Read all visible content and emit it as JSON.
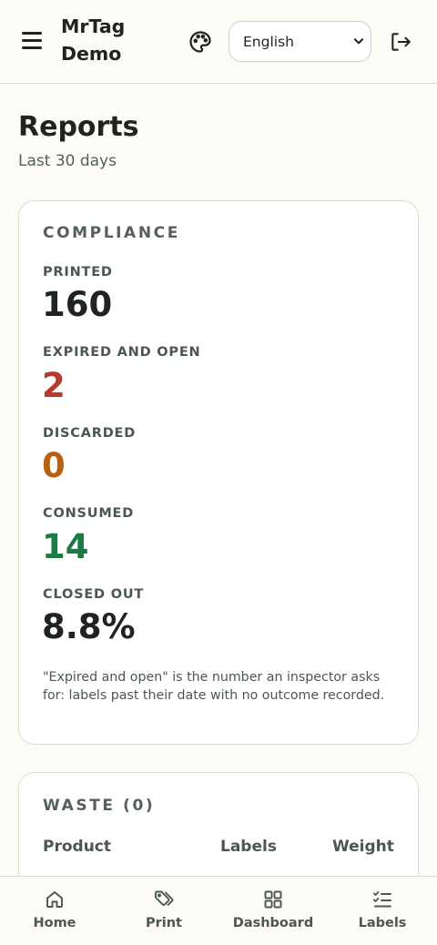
{
  "header": {
    "brand_line1": "MrTag",
    "brand_line2": "Demo",
    "language": {
      "selected": "English"
    }
  },
  "page": {
    "title": "Reports",
    "subtitle": "Last 30 days"
  },
  "compliance": {
    "title": "COMPLIANCE",
    "stats": [
      {
        "label": "PRINTED",
        "value": "160",
        "color": "#1f2420"
      },
      {
        "label": "EXPIRED AND OPEN",
        "value": "2",
        "color": "#b83a2e"
      },
      {
        "label": "DISCARDED",
        "value": "0",
        "color": "#b8600f"
      },
      {
        "label": "CONSUMED",
        "value": "14",
        "color": "#1d7a45"
      },
      {
        "label": "CLOSED OUT",
        "value": "8.8%",
        "color": "#1f2420"
      }
    ],
    "note": "\"Expired and open\" is the number an inspector asks for: labels past their date with no outcome recorded."
  },
  "waste": {
    "title": "WASTE (0)",
    "columns": [
      "Product",
      "Labels",
      "Weight"
    ]
  },
  "nav": {
    "items": [
      {
        "label": "Home",
        "icon": "home-icon"
      },
      {
        "label": "Print",
        "icon": "tag-icon"
      },
      {
        "label": "Dashboard",
        "icon": "grid-icon"
      },
      {
        "label": "Labels",
        "icon": "checklist-icon"
      }
    ]
  }
}
